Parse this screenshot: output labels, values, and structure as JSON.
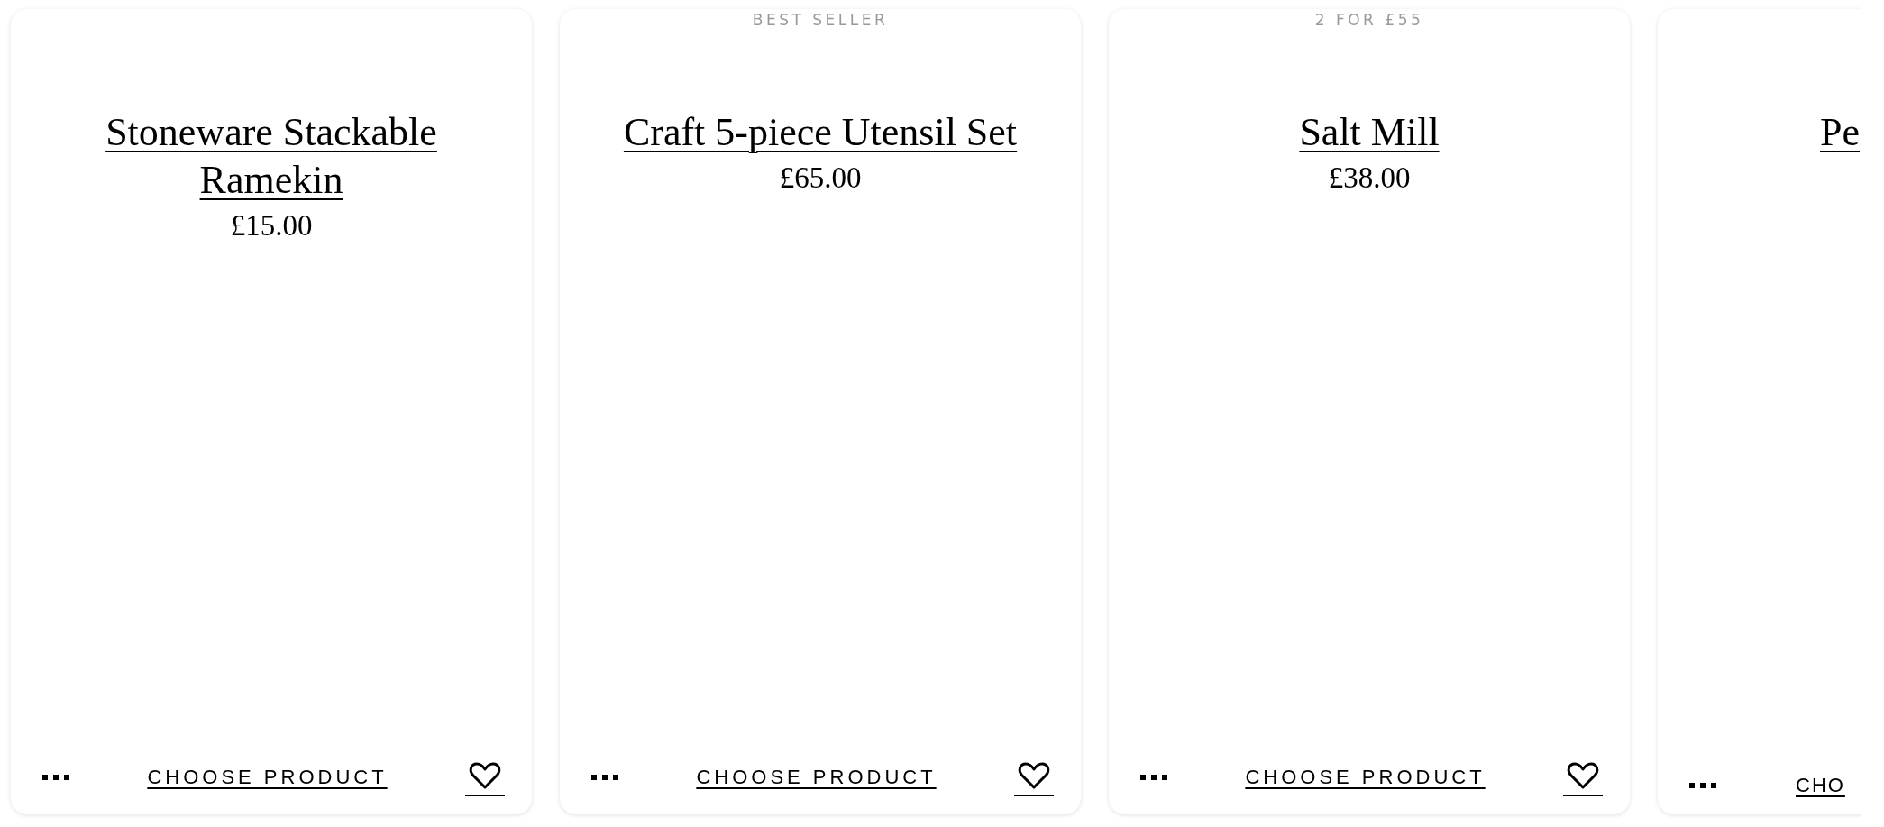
{
  "products": [
    {
      "title": "Stoneware Stackable Ramekin",
      "price": "£15.00",
      "action": "CHOOSE PRODUCT",
      "clipped": false
    },
    {
      "badge": "BEST SELLER",
      "title": "Craft 5-piece Utensil Set",
      "price": "£65.00",
      "action": "CHOOSE PRODUCT",
      "clipped": false
    },
    {
      "badge": "2 FOR £55",
      "title": "Salt Mill",
      "price": "£38.00",
      "action": "CHOOSE PRODUCT",
      "clipped": false
    },
    {
      "title": "Pe",
      "action": "CHO",
      "clipped": true
    }
  ]
}
